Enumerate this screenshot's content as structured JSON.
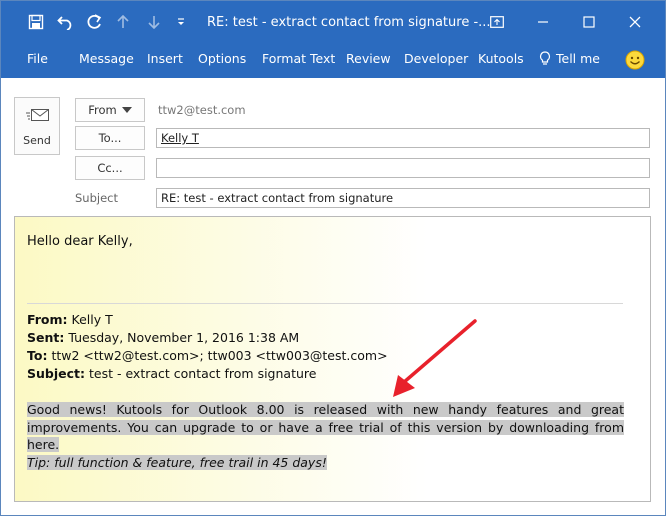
{
  "window": {
    "title": "RE: test - extract contact from signature  -..."
  },
  "ribbon": {
    "tabs": [
      "File",
      "Message",
      "Insert",
      "Options",
      "Format Text",
      "Review",
      "Developer",
      "Kutools",
      "Tell me"
    ]
  },
  "header": {
    "send_label": "Send",
    "from_label": "From",
    "to_label": "To...",
    "cc_label": "Cc...",
    "subject_label": "Subject",
    "from_address": "ttw2@test.com",
    "to_value": "Kelly T",
    "cc_value": "",
    "subject_value": "RE: test - extract contact from signature"
  },
  "body": {
    "greeting": "Hello dear Kelly,",
    "quoted": {
      "from_label": "From:",
      "from_value": "Kelly T",
      "sent_label": "Sent:",
      "sent_value": "Tuesday, November 1, 2016 1:38 AM",
      "to_label": "To:",
      "to_value": "ttw2 <ttw2@test.com>; ttw003 <ttw003@test.com>",
      "subject_label": "Subject:",
      "subject_value": "test - extract contact from signature"
    },
    "promo_text": "Good news! Kutools for Outlook 8.00 is released with new handy features and great improvements. You can upgrade to or have a free trial of this version by downloading from here.",
    "tip_text": "Tip: full function & feature, free trail in 45 days!"
  },
  "colors": {
    "title_bar": "#2b6bbf",
    "highlight": "#c9c9c9",
    "annotation_arrow": "#e8212b"
  },
  "icons": [
    "save-icon",
    "undo-icon",
    "redo-icon",
    "up-arrow-icon",
    "down-arrow-icon",
    "customize-qat-icon",
    "ribbon-display-icon",
    "minimize-icon",
    "maximize-icon",
    "close-icon",
    "lightbulb-icon",
    "smiley-icon",
    "send-envelope-icon",
    "annotation-arrow"
  ]
}
